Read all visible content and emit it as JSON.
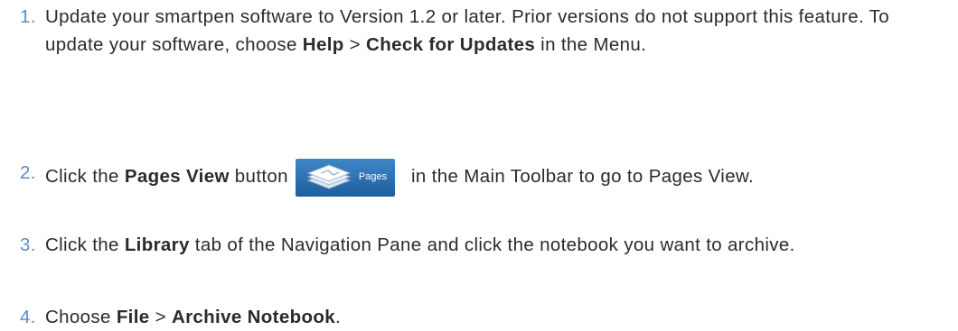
{
  "steps": [
    {
      "number": "1.",
      "parts": [
        "Update your smartpen software to Version 1.2 or later. Prior versions do not support this feature. To update your software, choose ",
        "Help",
        " > ",
        "Check for Updates",
        " in the Menu."
      ]
    },
    {
      "number": "2.",
      "parts": [
        "Click the ",
        "Pages View",
        " button",
        " in the Main Toolbar to go to Pages View."
      ],
      "toolbar_button": {
        "label": "Pages",
        "icon": "stacked-pages-icon",
        "background": "#2c6fb0"
      }
    },
    {
      "number": "3.",
      "parts": [
        "Click the ",
        "Library",
        " tab of the Navigation Pane and click the notebook you want to archive."
      ]
    },
    {
      "number": "4.",
      "parts": [
        "Choose ",
        "File",
        " > ",
        "Archive Notebook",
        "."
      ]
    }
  ],
  "colors": {
    "step_number": "#5b8fc2",
    "text": "#2b2b2b"
  }
}
